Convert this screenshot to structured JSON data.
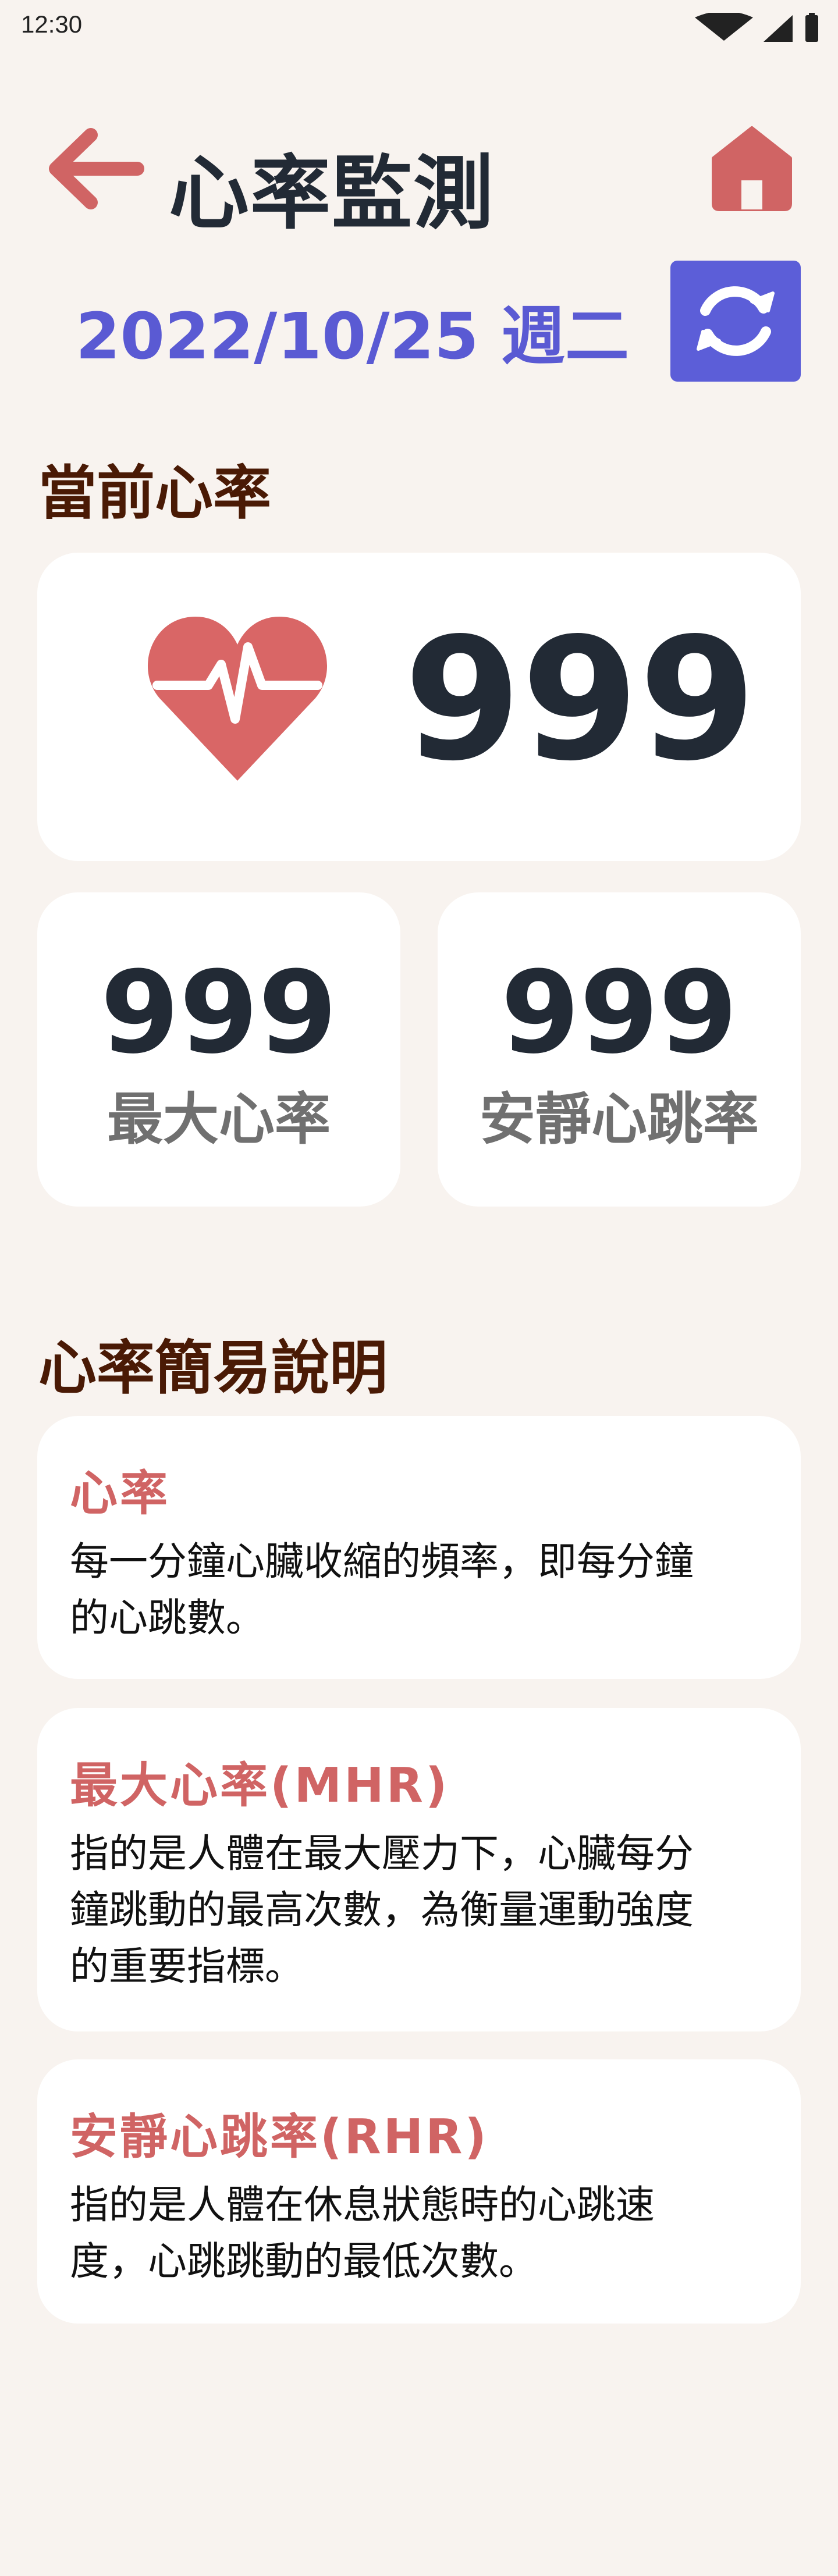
{
  "status_bar": {
    "time": "12:30"
  },
  "header": {
    "title": "心率監測"
  },
  "date": {
    "text": "2022/10/25 週二"
  },
  "current": {
    "section_title": "當前心率",
    "value": "999"
  },
  "stats": {
    "max": {
      "value": "999",
      "label": "最大心率"
    },
    "resting": {
      "value": "999",
      "label": "安靜心跳率"
    }
  },
  "info": {
    "section_title": "心率簡易說明",
    "cards": [
      {
        "title": "心率",
        "lines": [
          "每一分鐘心臟收縮的頻率，即每分鐘",
          "的心跳數。"
        ]
      },
      {
        "title": "最大心率(MHR)",
        "lines": [
          "指的是人體在最大壓力下，心臟每分",
          "鐘跳動的最高次數，為衡量運動強度",
          "的重要指標。"
        ]
      },
      {
        "title": "安靜心跳率(RHR)",
        "lines": [
          "指的是人體在休息狀態時的心跳速",
          "度，心跳跳動的最低次數。"
        ]
      }
    ]
  },
  "colors": {
    "background": "#f8f3ef",
    "accent_red": "#d06464",
    "accent_blue": "#5c5ed8",
    "dark_text": "#222a35",
    "section_brown": "#4a1a05"
  },
  "icons": {
    "back": "arrow-left-icon",
    "home": "home-icon",
    "refresh": "refresh-icon",
    "heart": "heart-pulse-icon",
    "wifi": "wifi-icon",
    "signal": "signal-icon",
    "battery": "battery-icon"
  }
}
